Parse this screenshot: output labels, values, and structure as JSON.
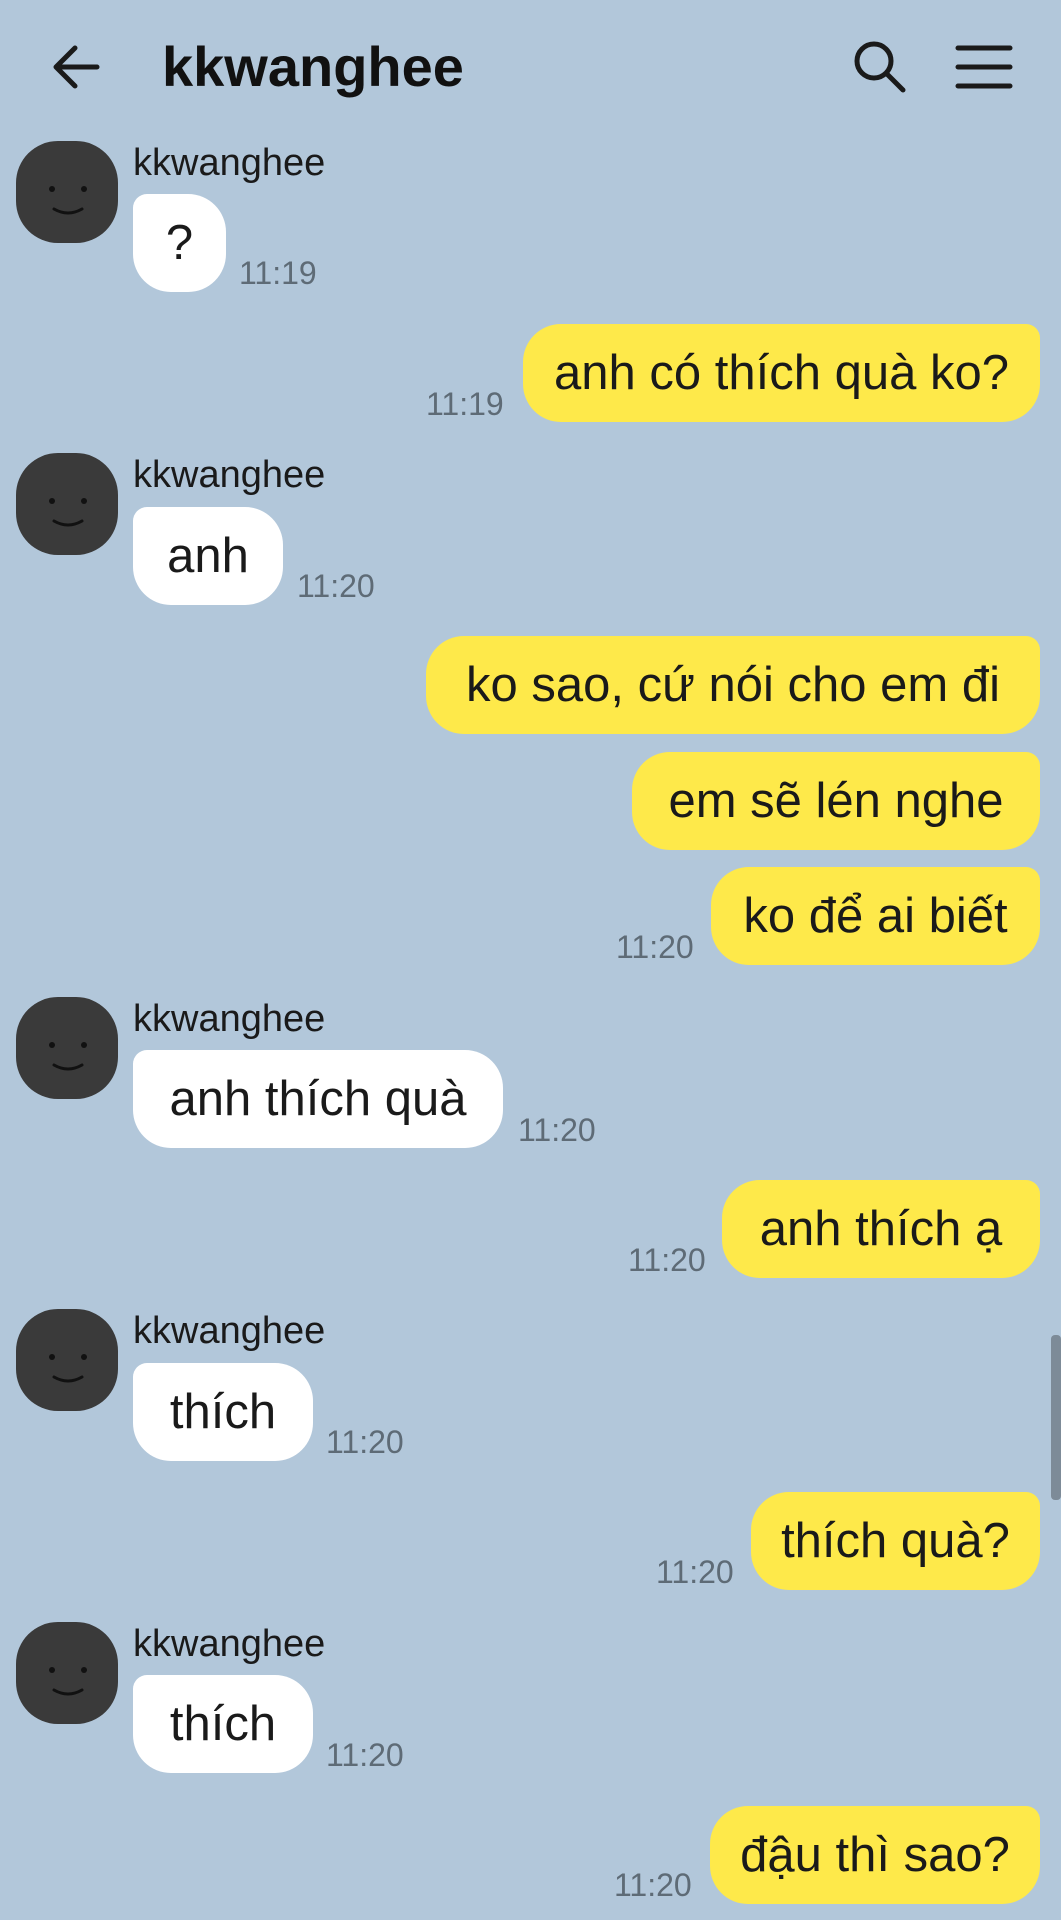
{
  "header": {
    "title": "kkwanghee",
    "back_icon": "arrow-left-icon",
    "search_icon": "search-icon",
    "menu_icon": "hamburger-menu-icon"
  },
  "colors": {
    "background": "#b2c7da",
    "incoming_bubble": "#ffffff",
    "outgoing_bubble": "#fee94a"
  },
  "messages": [
    {
      "sender": "kkwanghee",
      "text": "?",
      "time": "11:19"
    },
    {
      "text": "anh có thích quà ko?",
      "time": "11:19"
    },
    {
      "sender": "kkwanghee",
      "text": "anh",
      "time": "11:20"
    },
    {
      "text": "ko sao, cứ nói cho em đi"
    },
    {
      "text": "em sẽ lén nghe"
    },
    {
      "text": "ko để ai biết",
      "time": "11:20"
    },
    {
      "sender": "kkwanghee",
      "text": "anh thích quà",
      "time": "11:20"
    },
    {
      "text": "anh thích ạ",
      "time": "11:20"
    },
    {
      "sender": "kkwanghee",
      "text": "thích",
      "time": "11:20"
    },
    {
      "text": "thích quà?",
      "time": "11:20"
    },
    {
      "sender": "kkwanghee",
      "text": "thích",
      "time": "11:20"
    },
    {
      "text": "đậu thì sao?",
      "time": "11:20"
    }
  ]
}
